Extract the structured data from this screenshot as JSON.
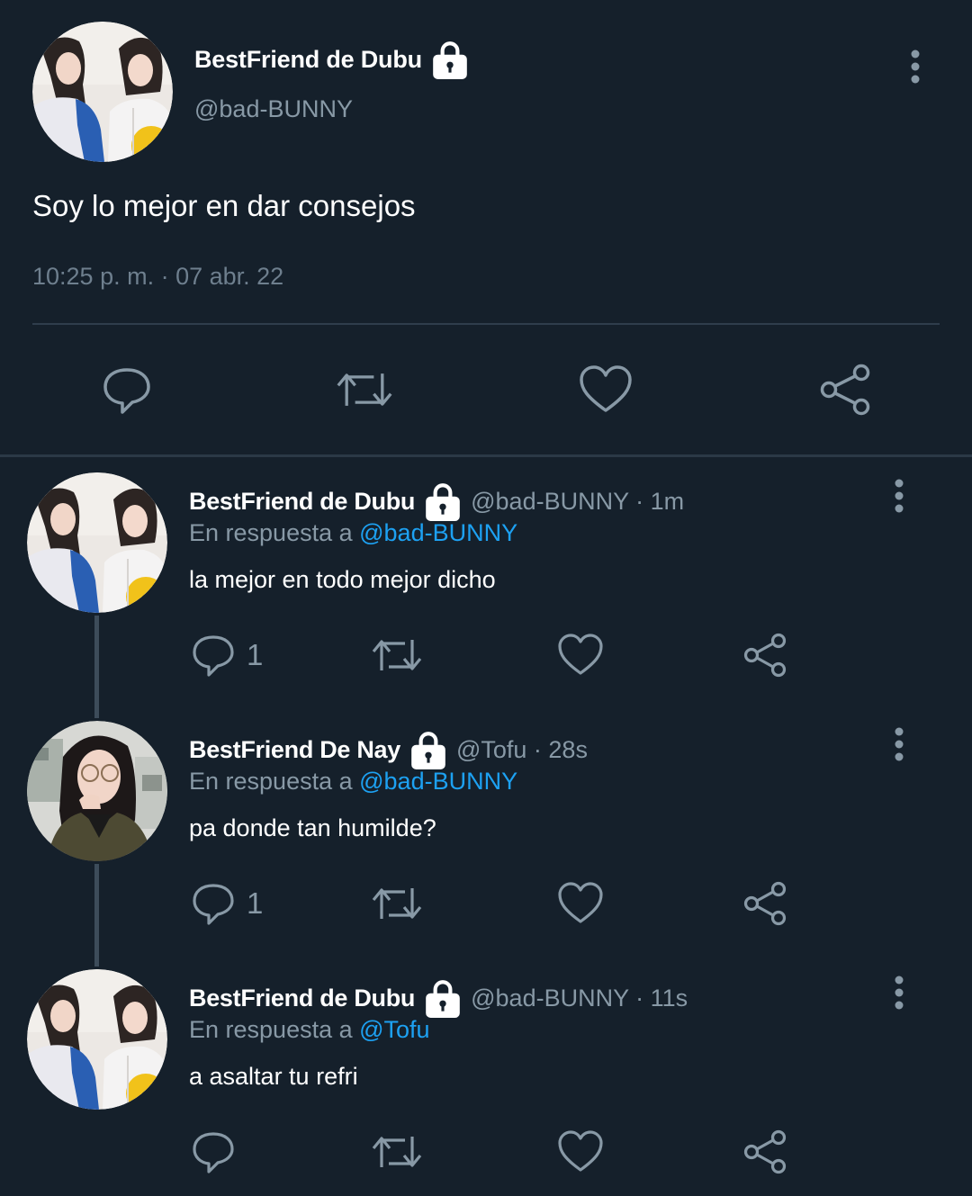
{
  "main_tweet": {
    "author_name": "BestFriend de Dubu",
    "handle": "@bad-BUNNY",
    "text": "Soy lo mejor en dar consejos",
    "timestamp": "10:25 p. m. · 07 abr. 22",
    "lock_icon": "lock-icon",
    "actions": [
      "reply-icon",
      "retweet-icon",
      "like-icon",
      "share-icon"
    ]
  },
  "replies": [
    {
      "author_name": "BestFriend de Dubu",
      "meta": "@bad-BUNNY · 1m",
      "reply_prefix": "En respuesta a ",
      "reply_to": "@bad-BUNNY",
      "text": "la mejor en todo mejor dicho",
      "reply_count": "1"
    },
    {
      "author_name": "BestFriend De Nay",
      "meta": "@Tofu · 28s",
      "reply_prefix": "En respuesta a ",
      "reply_to": "@bad-BUNNY",
      "text": "pa donde tan humilde?",
      "reply_count": "1"
    },
    {
      "author_name": "BestFriend de Dubu",
      "meta": "@bad-BUNNY · 11s",
      "reply_prefix": "En respuesta a ",
      "reply_to": "@Tofu",
      "text": "a asaltar tu refri",
      "reply_count": ""
    }
  ],
  "colors": {
    "background": "#15202b",
    "secondary_text": "#8899a6",
    "mention": "#1da1f2",
    "icon": "#8899a6"
  }
}
